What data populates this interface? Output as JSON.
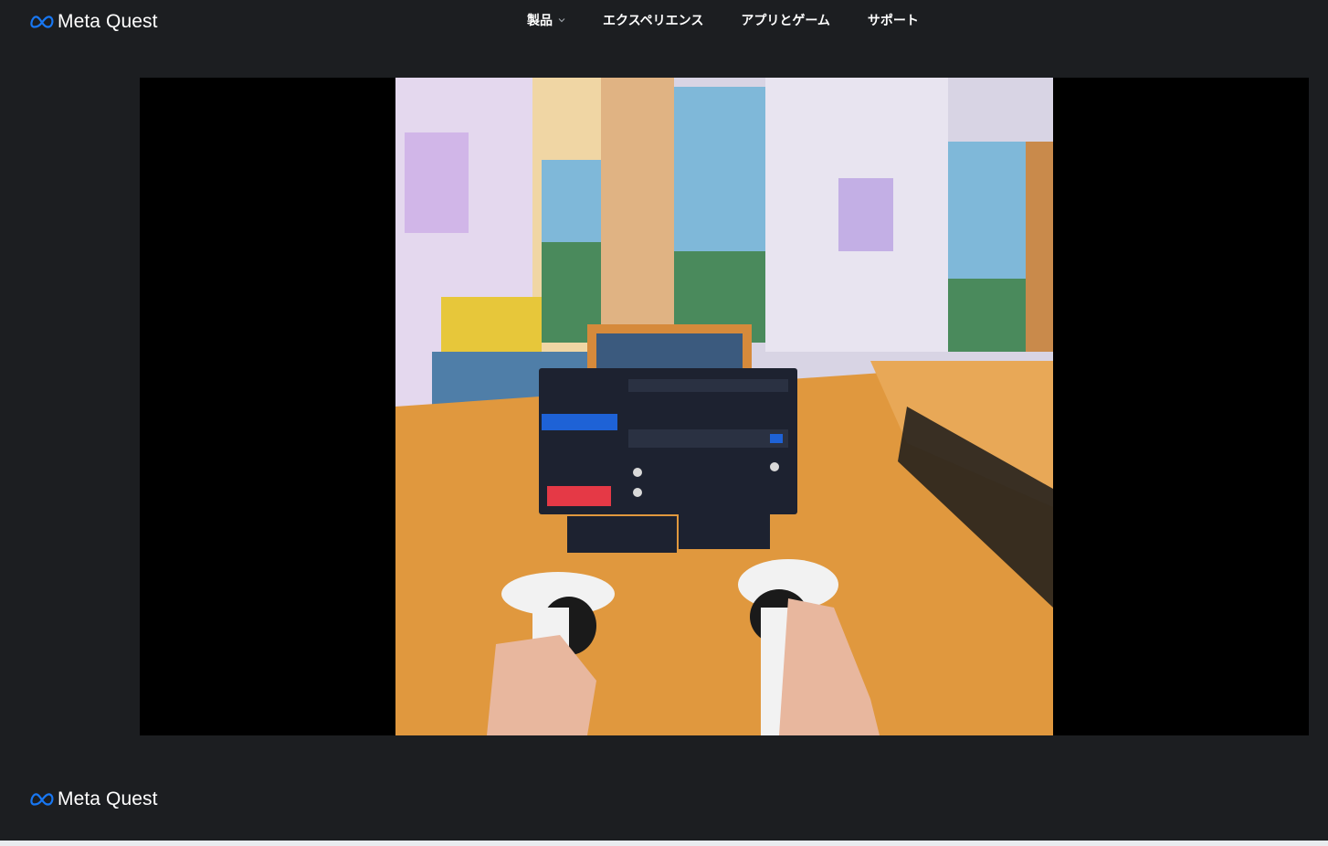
{
  "brand": {
    "name": "Meta Quest",
    "accent": "#1877f2"
  },
  "nav": {
    "items": [
      {
        "label": "製品",
        "has_dropdown": true
      },
      {
        "label": "エクスペリエンス"
      },
      {
        "label": "アプリとゲーム"
      },
      {
        "label": "サポート"
      }
    ]
  },
  "footer": {
    "brand_name": "Meta Quest"
  },
  "colors": {
    "page_bg": "#1c1e21",
    "video_bg": "#000000"
  }
}
